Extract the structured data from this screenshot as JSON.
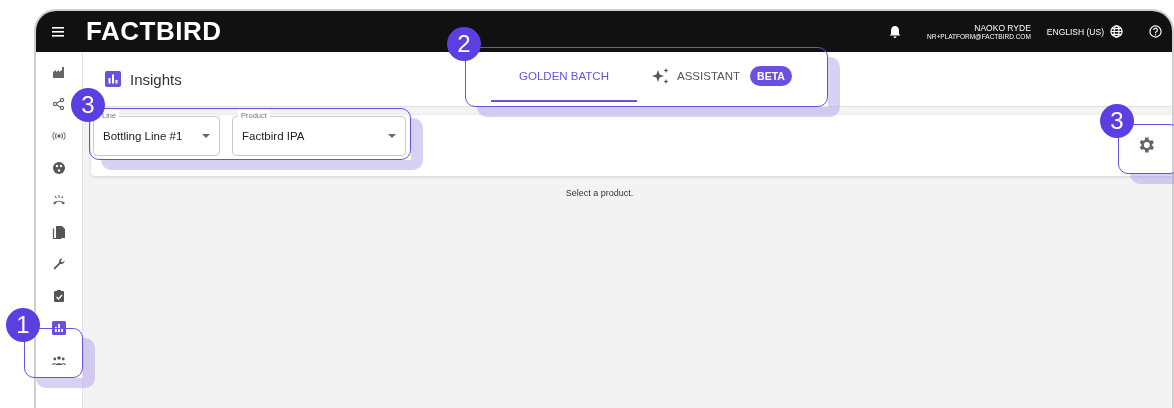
{
  "top_bar": {
    "logo": "FACTBIRD",
    "user_name": "NAOKO RYDE",
    "user_email": "NR+PLATFORM@FACTBIRD.COM",
    "language": "ENGLISH (US)"
  },
  "sidebar": {
    "items": [
      {
        "selected": false
      },
      {
        "selected": false
      },
      {
        "selected": false
      },
      {
        "selected": false
      },
      {
        "selected": false
      },
      {
        "selected": false
      },
      {
        "selected": false
      },
      {
        "selected": false
      },
      {
        "selected": true
      },
      {
        "selected": false
      }
    ]
  },
  "header": {
    "title": "Insights"
  },
  "tabs": [
    {
      "label": "GOLDEN BATCH",
      "selected": true
    },
    {
      "label": "ASSISTANT",
      "selected": false,
      "badge": "BETA"
    }
  ],
  "filters": [
    {
      "label": "Line",
      "value": "Bottling Line #1"
    },
    {
      "label": "Product",
      "value": "Factbird IPA"
    }
  ],
  "message": "Select a product.",
  "callouts": [
    {
      "number": "1"
    },
    {
      "number": "2"
    },
    {
      "number": "3"
    },
    {
      "number": "3"
    }
  ]
}
